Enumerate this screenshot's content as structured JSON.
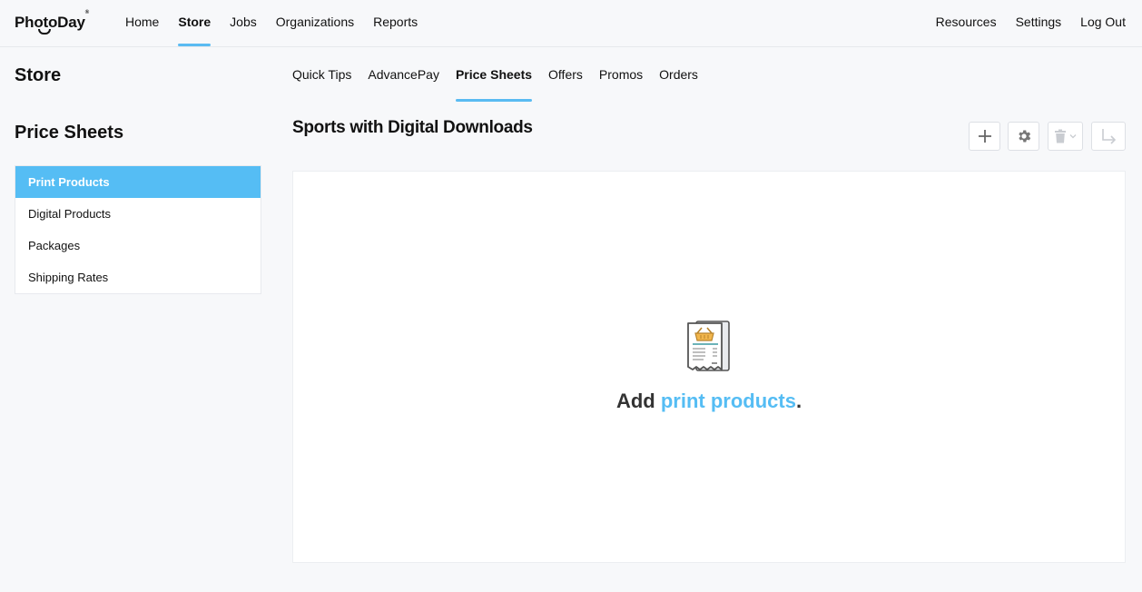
{
  "app": {
    "logo": "PhotoDay"
  },
  "topnav": {
    "left": [
      "Home",
      "Store",
      "Jobs",
      "Organizations",
      "Reports"
    ],
    "active": "Store",
    "right": [
      "Resources",
      "Settings",
      "Log Out"
    ]
  },
  "sidebar": {
    "page_title": "Store",
    "section_title": "Price Sheets",
    "items": [
      "Print Products",
      "Digital Products",
      "Packages",
      "Shipping Rates"
    ],
    "active": "Print Products"
  },
  "subtabs": {
    "items": [
      "Quick Tips",
      "AdvancePay",
      "Price Sheets",
      "Offers",
      "Promos",
      "Orders"
    ],
    "active": "Price Sheets"
  },
  "main": {
    "title": "Sports with Digital Downloads",
    "toolbar_icons": [
      "plus-icon",
      "gear-icon",
      "trash-icon",
      "export-arrow-icon"
    ],
    "empty_state": {
      "prefix": "Add ",
      "link": "print products",
      "suffix": ".",
      "icon": "receipt-basket-icon"
    }
  },
  "colors": {
    "accent": "#55bdf4",
    "background": "#f7f8fa"
  }
}
